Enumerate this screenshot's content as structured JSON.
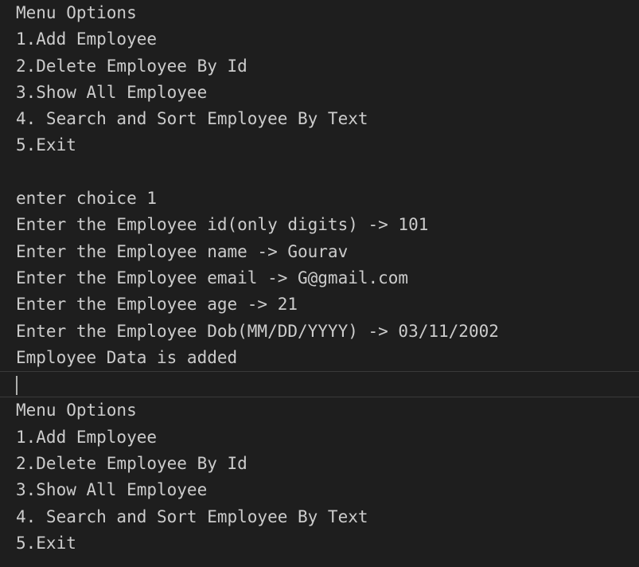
{
  "terminal": {
    "first_menu": [
      "Menu Options",
      "1.Add Employee",
      "2.Delete Employee By Id",
      "3.Show All Employee",
      "4. Search and Sort Employee By Text",
      "5.Exit"
    ],
    "session": [
      "enter choice 1",
      "Enter the Employee id(only digits) -> 101",
      "Enter the Employee name -> Gourav",
      "Enter the Employee email -> G@gmail.com",
      "Enter the Employee age -> 21",
      "Enter the Employee Dob(MM/DD/YYYY) -> 03/11/2002",
      "Employee Data is added"
    ],
    "second_menu": [
      "Menu Options",
      "1.Add Employee",
      "2.Delete Employee By Id",
      "3.Show All Employee",
      "4. Search and Sort Employee By Text",
      "5.Exit"
    ]
  }
}
